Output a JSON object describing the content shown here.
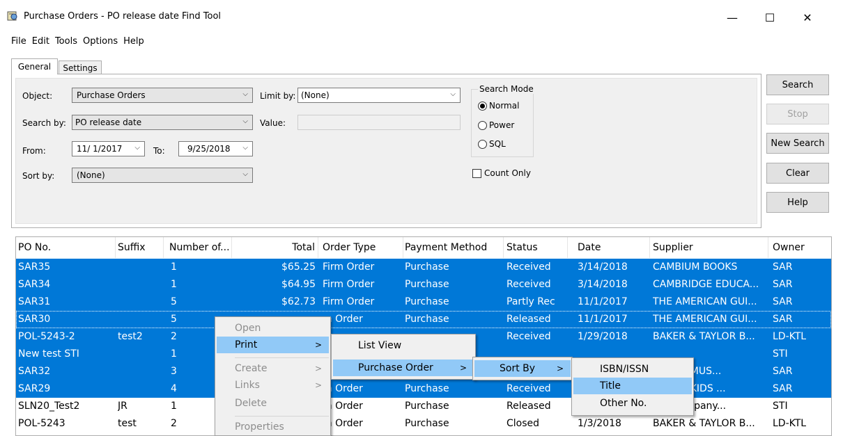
{
  "window": {
    "title": "Purchase Orders - PO release date Find Tool",
    "minimize": "—",
    "maximize": "☐",
    "close": "✕"
  },
  "menu": [
    "File",
    "Edit",
    "Tools",
    "Options",
    "Help"
  ],
  "tabs": [
    "General",
    "Settings"
  ],
  "form": {
    "object_label": "Object:",
    "object_value": "Purchase Orders",
    "limit_label": "Limit by:",
    "limit_value": "(None)",
    "searchby_label": "Search by:",
    "searchby_value": "PO release date",
    "value_label": "Value:",
    "value_value": "",
    "from_label": "From:",
    "from_value": "11/ 1/2017",
    "to_label": "To:",
    "to_value": "9/25/2018",
    "sortby_label": "Sort by:",
    "sortby_value": "(None)",
    "search_mode_title": "Search Mode",
    "modes": [
      "Normal",
      "Power",
      "SQL"
    ],
    "selected_mode": "Normal",
    "count_only_label": "Count Only",
    "count_only_checked": false
  },
  "buttons": {
    "search": "Search",
    "stop": "Stop",
    "new_search": "New Search",
    "clear": "Clear",
    "help": "Help"
  },
  "table": {
    "columns": [
      "PO No.",
      "Suffix",
      "Number of...",
      "Total",
      "Order Type",
      "Payment Method",
      "Status",
      "Date",
      "Supplier",
      "Owner"
    ],
    "rows": [
      {
        "po": "SAR35",
        "suffix": "",
        "number": "1",
        "total": "$65.25",
        "type": "Firm Order",
        "payment": "Purchase",
        "status": "Received",
        "date": "3/14/2018",
        "supplier": "CAMBIUM BOOKS",
        "owner": "SAR",
        "selected": true
      },
      {
        "po": "SAR34",
        "suffix": "",
        "number": "1",
        "total": "$64.95",
        "type": "Firm Order",
        "payment": "Purchase",
        "status": "Received",
        "date": "3/14/2018",
        "supplier": "CAMBRIDGE EDUCA...",
        "owner": "SAR",
        "selected": true
      },
      {
        "po": "SAR31",
        "suffix": "",
        "number": "5",
        "total": "$62.73",
        "type": "Firm Order",
        "payment": "Purchase",
        "status": "Partly Rec",
        "date": "11/1/2017",
        "supplier": "THE AMERICAN GUI...",
        "owner": "SAR",
        "selected": true
      },
      {
        "po": "SAR30",
        "suffix": "",
        "number": "5",
        "total": "",
        "type": "m Order",
        "payment": "Purchase",
        "status": "Released",
        "date": "11/1/2017",
        "supplier": "THE AMERICAN GUI...",
        "owner": "SAR",
        "selected": true
      },
      {
        "po": "POL-5243-2",
        "suffix": "test2",
        "number": "2",
        "total": "",
        "type": "",
        "payment": "",
        "status": "Received",
        "date": "1/29/2018",
        "supplier": "BAKER & TAYLOR B...",
        "owner": "LD-KTL",
        "selected": true
      },
      {
        "po": "New test STI",
        "suffix": "",
        "number": "1",
        "total": "",
        "type": "",
        "payment": "",
        "status": "",
        "date": "",
        "supplier": "",
        "owner": "STI",
        "selected": true
      },
      {
        "po": "SAR32",
        "suffix": "",
        "number": "3",
        "total": "",
        "type": "",
        "payment": "",
        "status": "",
        "date": "",
        "supplier": "NDACK MUS...",
        "owner": "SAR",
        "selected": true
      },
      {
        "po": "SAR29",
        "suffix": "",
        "number": "4",
        "total": "",
        "type": "m Order",
        "payment": "Purchase",
        "status": "Received",
        "date": "",
        "supplier": "NDACK KIDS ...",
        "owner": "SAR",
        "selected": true
      },
      {
        "po": "SLN20_Test2",
        "suffix": "JR",
        "number": "1",
        "total": "",
        "type": "m Order",
        "payment": "Purchase",
        "status": "Released",
        "date": "",
        "supplier": "thy Company...",
        "owner": "STI",
        "selected": false
      },
      {
        "po": "POL-5243",
        "suffix": "test",
        "number": "2",
        "total": "",
        "type": "m Order",
        "payment": "Purchase",
        "status": "Closed",
        "date": "1/3/2018",
        "supplier": "BAKER & TAYLOR B...",
        "owner": "LD-KTL",
        "selected": false
      }
    ]
  },
  "context_menu": {
    "items": [
      {
        "label": "Open",
        "disabled": true
      },
      {
        "label": "Print",
        "disabled": false,
        "highlighted": true,
        "submenu": true
      },
      {
        "label": "Create",
        "disabled": true,
        "submenu": true
      },
      {
        "label": "Links",
        "disabled": true,
        "submenu": true
      },
      {
        "label": "Delete",
        "disabled": true
      },
      {
        "label": "Properties",
        "disabled": true
      }
    ]
  },
  "print_submenu": {
    "items": [
      {
        "label": "List View"
      },
      {
        "label": "Purchase Order",
        "highlighted": true,
        "submenu": true
      }
    ]
  },
  "po_submenu": {
    "items": [
      {
        "label": "Sort By",
        "highlighted": true,
        "submenu": true
      }
    ]
  },
  "sortby_submenu": {
    "items": [
      {
        "label": "ISBN/ISSN"
      },
      {
        "label": "Title",
        "highlighted": true
      },
      {
        "label": "Other No."
      }
    ]
  },
  "submenu_arrow": ">",
  "combo_arrow": "⌵"
}
